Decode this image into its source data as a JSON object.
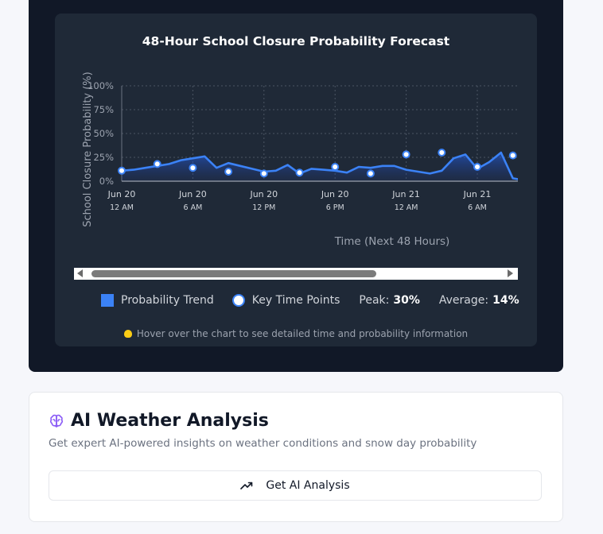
{
  "chart_data": {
    "type": "area",
    "title": "48-Hour School Closure Probability Forecast",
    "xlabel": "Time (Next 48 Hours)",
    "ylabel": "School Closure Probability (%)",
    "ylim": [
      0,
      100
    ],
    "yticks": [
      "100%",
      "75%",
      "50%",
      "25%",
      "0%"
    ],
    "xticks": [
      {
        "date": "Jun 20",
        "time": "12 AM"
      },
      {
        "date": "Jun 20",
        "time": "6 AM"
      },
      {
        "date": "Jun 20",
        "time": "12 PM"
      },
      {
        "date": "Jun 20",
        "time": "6 PM"
      },
      {
        "date": "Jun 21",
        "time": "12 AM"
      },
      {
        "date": "Jun 21",
        "time": "6 AM"
      }
    ],
    "grid": true,
    "series": [
      {
        "name": "Probability Trend",
        "color": "#3b82f6",
        "points": [
          [
            0,
            11
          ],
          [
            1,
            12
          ],
          [
            2,
            14
          ],
          [
            3,
            16
          ],
          [
            4,
            18
          ],
          [
            5,
            22
          ],
          [
            6,
            24
          ],
          [
            7,
            26
          ],
          [
            8,
            14
          ],
          [
            9,
            19
          ],
          [
            10,
            16
          ],
          [
            11,
            13
          ],
          [
            12,
            10
          ],
          [
            13,
            11
          ],
          [
            14,
            17
          ],
          [
            15,
            8
          ],
          [
            16,
            13
          ],
          [
            17,
            12
          ],
          [
            18,
            11
          ],
          [
            19,
            9
          ],
          [
            20,
            15
          ],
          [
            21,
            14
          ],
          [
            22,
            16
          ],
          [
            23,
            16
          ],
          [
            24,
            12
          ],
          [
            25,
            10
          ],
          [
            26,
            8
          ],
          [
            27,
            11
          ],
          [
            28,
            24
          ],
          [
            29,
            28
          ],
          [
            30,
            13
          ],
          [
            31,
            20
          ],
          [
            32,
            30
          ],
          [
            33,
            3
          ],
          [
            34,
            1
          ],
          [
            35,
            16
          ],
          [
            36,
            1
          ],
          [
            37,
            10
          ],
          [
            38,
            28
          ],
          [
            38.8,
            20
          ]
        ]
      },
      {
        "name": "Key Time Points",
        "points": [
          [
            0,
            11
          ],
          [
            3,
            18
          ],
          [
            6,
            14
          ],
          [
            9,
            10
          ],
          [
            12,
            8
          ],
          [
            15,
            9
          ],
          [
            18,
            15
          ],
          [
            21,
            8
          ],
          [
            24,
            28
          ],
          [
            27,
            30
          ],
          [
            30,
            15
          ],
          [
            33,
            27
          ]
        ]
      }
    ],
    "legend": [
      "Probability Trend",
      "Key Time Points"
    ],
    "legend_position": "bottom",
    "peak_label": "Peak:",
    "peak_value": "30%",
    "average_label": "Average:",
    "average_value": "14%",
    "hint": "Hover over the chart to see detailed time and probability information"
  },
  "ai_analysis": {
    "title": "AI Weather Analysis",
    "subtitle": "Get expert AI-powered insights on weather conditions and snow day probability",
    "button_label": "Get AI Analysis"
  }
}
